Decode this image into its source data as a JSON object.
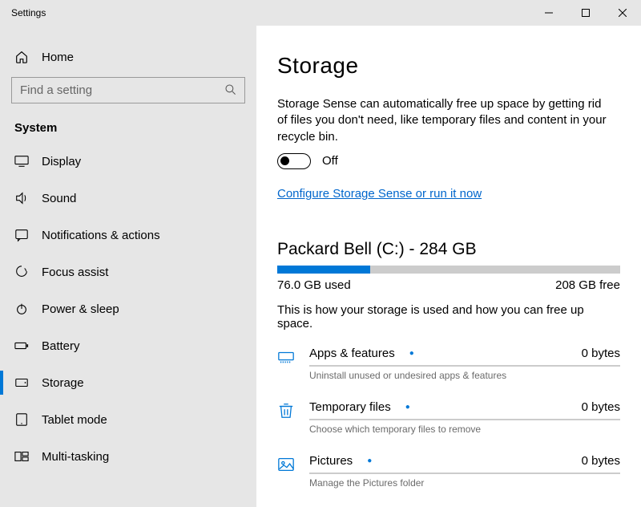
{
  "window": {
    "title": "Settings"
  },
  "sidebar": {
    "home": "Home",
    "search_placeholder": "Find a setting",
    "section": "System",
    "items": [
      {
        "label": "Display"
      },
      {
        "label": "Sound"
      },
      {
        "label": "Notifications & actions"
      },
      {
        "label": "Focus assist"
      },
      {
        "label": "Power & sleep"
      },
      {
        "label": "Battery"
      },
      {
        "label": "Storage"
      },
      {
        "label": "Tablet mode"
      },
      {
        "label": "Multi-tasking"
      }
    ]
  },
  "main": {
    "title": "Storage",
    "sense_desc": "Storage Sense can automatically free up space by getting rid of files you don't need, like temporary files and content in your recycle bin.",
    "toggle_label": "Off",
    "config_link": "Configure Storage Sense or run it now",
    "drive_title": "Packard Bell (C:) - 284 GB",
    "used_pct": 27,
    "used_label": "76.0 GB used",
    "free_label": "208 GB free",
    "how": "This is how your storage is used and how you can free up space.",
    "categories": [
      {
        "name": "Apps & features",
        "size": "0 bytes",
        "sub": "Uninstall unused or undesired apps & features"
      },
      {
        "name": "Temporary files",
        "size": "0 bytes",
        "sub": "Choose which temporary files to remove"
      },
      {
        "name": "Pictures",
        "size": "0 bytes",
        "sub": "Manage the Pictures folder"
      }
    ]
  }
}
